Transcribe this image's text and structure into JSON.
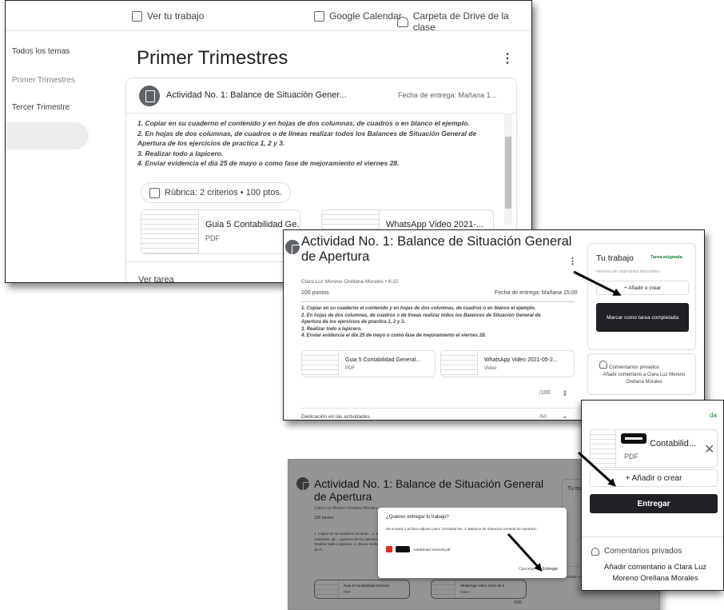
{
  "panel1": {
    "topbar": {
      "view_work": "Ver tu trabajo",
      "google_calendar": "Google Calendar",
      "drive_folder": "Carpeta de Drive de la clase"
    },
    "sidebar": {
      "items": [
        {
          "label": "Todos los temas"
        },
        {
          "label": "Primer Trimestres"
        },
        {
          "label": "Tercer Trimestre",
          "active": true
        }
      ]
    },
    "topic_title": "Primer Trimestres",
    "card": {
      "title": "Actividad No. 1: Balance de Situación Gener...",
      "due": "Fecha de entrega: Mañana 1...",
      "instructions": [
        "1. Copiar en su cuaderno el contenido y en hojas de dos columnas, de cuadros o en blanco el ejemplo.",
        "2. En hojas de dos columnas, de cuadros o de líneas realizar todos los Balances de Situación General de",
        "Apertura de los ejercicios de practica 1, 2 y 3.",
        "3. Realizar todo a lapicero.",
        "4. Enviar evidencia el día 25 de mayo o como fase de mejoramiento el viernes 28."
      ],
      "rubric": "Rúbrica: 2 criterios • 100 ptos.",
      "attachments": [
        {
          "name": "Guia 5 Contabilidad Ge...",
          "type": "PDF"
        },
        {
          "name": "WhatsApp Video 2021-...",
          "type": ""
        }
      ],
      "view_task": "Ver tarea"
    }
  },
  "panel2": {
    "title": "Actividad No. 1: Balance de Situación General de Apertura",
    "author": "Clara Luz Moreno Orellana Morales • 6:10",
    "points": "100 puntos",
    "due": "Fecha de entrega: Mañana 15:00",
    "instructions": [
      "1. Copiar en su cuaderno el contenido y en hojas de dos columnas, de cuadros o en blanco el ejemplo.",
      "2. En hojas de dos columnas, de cuadros o de líneas realizar todos los Balances de Situación General de",
      "Apertura de los ejercicios de practica 1, 2 y 3.",
      "3. Realizar todo a lapicero.",
      "4. Enviar evidencia el día 25 de mayo o como fase de mejoramiento el viernes 28."
    ],
    "attachments": [
      {
        "name": "Guia 5 Contabilidad General...",
        "type": "PDF"
      },
      {
        "name": "WhatsApp Video 2021-05-2...",
        "type": "Video"
      }
    ],
    "score_total": "/100",
    "criterion": {
      "label": "Dedicación en las actividades",
      "score": "/50"
    },
    "your_work": {
      "title": "Tu trabajo",
      "status": "Tarea asignada",
      "originality": "Informes de originalidad disponibles",
      "add_create": "+ Añadir o crear",
      "mark_done": "Marcar como tarea completada"
    },
    "private_comments": {
      "title": "Comentarios privados",
      "add_link": "Añadir comentario a Clara Luz Moreno Orellana Morales"
    }
  },
  "panel3": {
    "title": "Actividad No. 1: Balance de Situación General de Apertura",
    "author": "Clara Luz Moreno Orellana Morales",
    "points": "100 puntos",
    "instructions": "1. Copiar en su cuaderno el conte... 2. En hojas de dos columnas, de... Apertura de los ejercicios de pra... 3. Realizar todo a lapicero. 4. Enviar evidencia el día 25 de m...",
    "side_label": "Tu tra",
    "dialog": {
      "title": "¿Quieres entregar tu trabajo?",
      "message": "Se enviará 1 archivo adjunto para \"Actividad No. 1: Balance de Situación General de Apertura\".",
      "file": "ontabilidad General.pdf",
      "cancel": "Cancelar",
      "submit": "Entregar"
    },
    "attachments": [
      {
        "name": "Guia 5 Contabilidad General",
        "type": "PDF"
      },
      {
        "name": "WhatsApp Video 2021-05-2",
        "type": "Video"
      }
    ],
    "score": "/100",
    "partial_comment": "Añadir comentario a Clara Luz Moreno Orellana Morales"
  },
  "panel4": {
    "status": "da",
    "file": {
      "name": "Contabilid...",
      "type": "PDF"
    },
    "add_create": "+ Añadir o crear",
    "submit": "Entregar",
    "private_comments": {
      "title": "Comentarios privados",
      "add_link": "Añadir comentario a Clara Luz Moreno Orellana Morales"
    }
  },
  "colors": {
    "accent_dark": "#202124",
    "assigned_green": "#188038",
    "pdf_red": "#d93025"
  }
}
